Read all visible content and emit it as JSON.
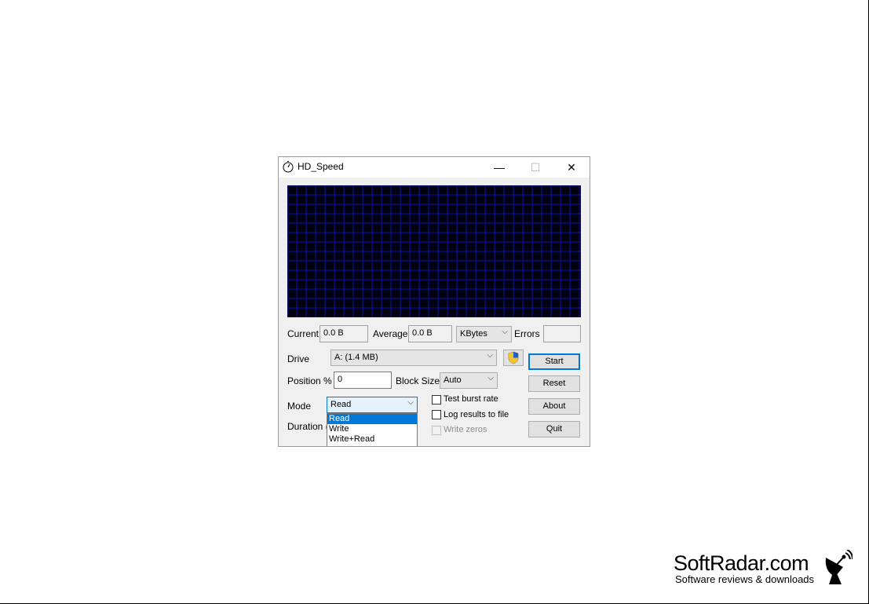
{
  "window": {
    "title": "HD_Speed",
    "controls": {
      "minimize": "—",
      "maximize": "☐",
      "close": "✕"
    }
  },
  "stats": {
    "current_label": "Current",
    "current_value": "0.0 B",
    "average_label": "Average",
    "average_value": "0.0 B",
    "unit_select": "KBytes",
    "errors_label": "Errors",
    "errors_value": ""
  },
  "drive": {
    "label": "Drive",
    "value": "A: (1.4 MB)"
  },
  "position": {
    "label": "Position %",
    "value": "0",
    "block_size_label": "Block Size",
    "block_size_value": "Auto"
  },
  "mode": {
    "label": "Mode",
    "value": "Read",
    "options": [
      "Read",
      "Write",
      "Write+Read"
    ]
  },
  "duration": {
    "label": "Duration ("
  },
  "checkboxes": {
    "burst": {
      "label": "Test burst rate",
      "checked": false
    },
    "log": {
      "label": "Log results to file",
      "checked": false
    },
    "zeros": {
      "label": "Write zeros",
      "checked": false,
      "disabled": true
    }
  },
  "buttons": {
    "start": "Start",
    "reset": "Reset",
    "about": "About",
    "quit": "Quit"
  },
  "watermark": {
    "name": "SoftRadar.com",
    "tagline": "Software reviews & downloads"
  },
  "colors": {
    "graph_bg": "#000010",
    "grid": "#1010a0",
    "accent": "#0078d7"
  },
  "icons": [
    "stopwatch-icon",
    "shield-uac-icon",
    "chevron-down-icon",
    "satellite-dish-icon"
  ]
}
